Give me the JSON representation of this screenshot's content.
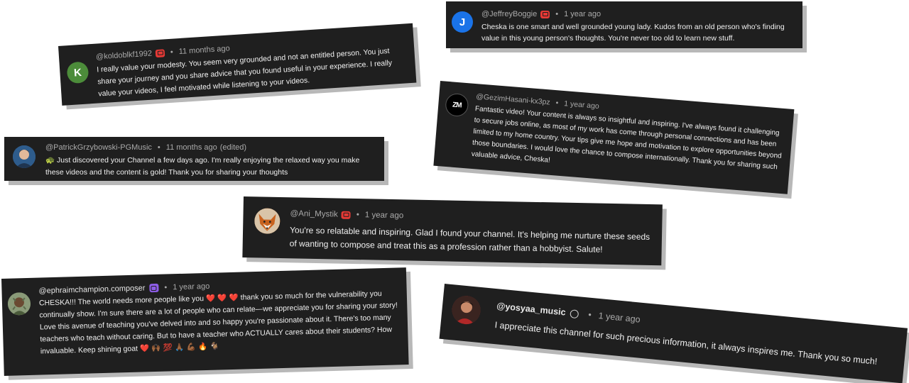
{
  "comments": [
    {
      "handle": "@JeffreyBoggie",
      "badge": "red",
      "time": "1 year ago",
      "avatar_letter": "J",
      "avatar_color": "#1a73e8",
      "text": "Cheska is one smart and well grounded young lady. Kudos from an old person who's finding value in this young person's thoughts. You're never too old to learn new stuff."
    },
    {
      "handle": "@koldoblkf1992",
      "badge": "red",
      "time": "11 months ago",
      "avatar_letter": "K",
      "avatar_color": "#4c8c3a",
      "text": "I really value your modesty. You seem very grounded and not an entitled person. You just share your journey and you share advice that you found useful in your experience. I really value your videos, I feel motivated while listening to your videos."
    },
    {
      "handle": "@GezimHasani-kx3pz",
      "time": "1 year ago",
      "avatar_letter": "ZM",
      "avatar_color": "#000000",
      "text": "Fantastic video! Your content is always so insightful and inspiring. I've always found it challenging to secure jobs online, as most of my work has come through personal connections and has been limited to my home country. Your tips give me hope and motivation to explore opportunities beyond those boundaries. I would love the chance to compose internationally. Thank you for sharing such valuable advice, Cheska!"
    },
    {
      "handle": "@PatrickGrzybowski-PGMusic",
      "time": "11 months ago",
      "edited": "(edited)",
      "avatar_color": "#3b6aa0",
      "emoji": "🐢",
      "text": "Just discovered your Channel a few days ago. I'm really enjoying the relaxed way you make these videos and the content is gold! Thank you for sharing your thoughts"
    },
    {
      "handle": "@Ani_Mystik",
      "badge": "red",
      "time": "1 year ago",
      "avatar_color": "#c8742a",
      "text": "You're so relatable and inspiring. Glad I found your channel. It's helping me nurture these seeds of wanting to compose and treat this as a profession rather than a hobbyist. Salute!"
    },
    {
      "handle": "@ephraimchampion.composer",
      "badge": "purple",
      "time": "1 year ago",
      "avatar_color": "#7a8a6a",
      "text_line1": "CHESKA!!! The world needs more people like you",
      "hearts": "❤️ ❤️ ❤️",
      "text_line1b": "thank you so much for the vulnerability",
      "text_rest": "you continually show. I'm sure there are a lot of people who can relate—we appreciate you for sharing your story! Love this avenue of teaching you've delved into and so happy you're passionate about it. There's too many teachers who teach without caring. But to have a teacher who ACTUALLY cares about their students? How invaluable. Keep shining goat",
      "emoji_tail": "❤️ 🙌🏾 💯 🙏🏾 💪🏾 🔥 🐐"
    },
    {
      "handle": "@yosyaa_music",
      "verified": true,
      "time": "1 year ago",
      "avatar_color": "#8b2a2a",
      "text": "I appreciate this channel for such precious information, it always inspires me. Thank you so much!"
    }
  ],
  "separator": "•"
}
